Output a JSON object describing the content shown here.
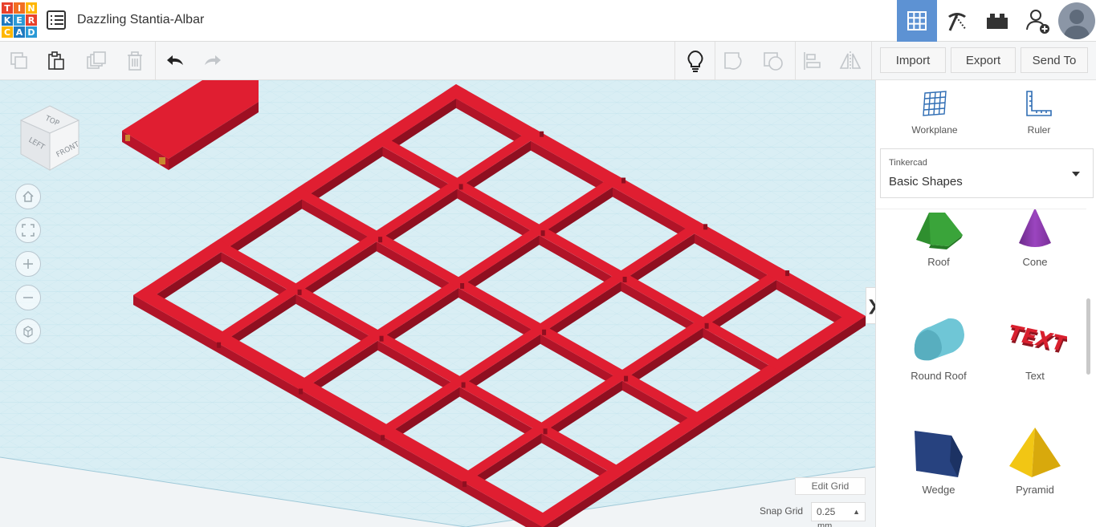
{
  "app": {
    "logo_letters": [
      "T",
      "I",
      "N",
      "K",
      "E",
      "R",
      "C",
      "A",
      "D"
    ],
    "logo_colors": [
      "#e8412c",
      "#f26e22",
      "#ffb600",
      "#1f7ac0",
      "#2b9ad6",
      "#e8412c",
      "#ffb600",
      "#1f7ac0",
      "#2b9ad6"
    ],
    "design_title": "Dazzling Stantia-Albar"
  },
  "header": {
    "buttons": [
      {
        "name": "3d-design-view-button",
        "icon": "grid-icon",
        "active": true
      },
      {
        "name": "codeblocks-button",
        "icon": "pickaxe-icon",
        "active": false
      },
      {
        "name": "bricks-button",
        "icon": "brick-icon",
        "active": false
      },
      {
        "name": "add-user-button",
        "icon": "user-plus-icon",
        "active": false
      }
    ],
    "active_color": "#5d92d3"
  },
  "toolbar": {
    "import_label": "Import",
    "export_label": "Export",
    "send_to_label": "Send To"
  },
  "viewcube": {
    "top": "TOP",
    "left": "LEFT",
    "front": "FRONT"
  },
  "canvas": {
    "grid_color": "#b9dfe9",
    "shape_color": "#e01e31",
    "edit_grid_label": "Edit Grid",
    "snap_grid_label": "Snap Grid",
    "snap_value": "0.25",
    "snap_unit": "mm"
  },
  "panel": {
    "tools": [
      {
        "label": "Workplane",
        "icon": "workplane-icon"
      },
      {
        "label": "Ruler",
        "icon": "ruler-icon"
      }
    ],
    "library": {
      "source": "Tinkercad",
      "selected": "Basic Shapes"
    },
    "shapes": [
      {
        "label": "Roof",
        "color": "#3aa43a"
      },
      {
        "label": "Cone",
        "color": "#8a3aa8"
      },
      {
        "label": "Round Roof",
        "color": "#6fc6d6"
      },
      {
        "label": "Text",
        "color": "#d9202e"
      },
      {
        "label": "Wedge",
        "color": "#27427f"
      },
      {
        "label": "Pyramid",
        "color": "#f2c614"
      }
    ]
  }
}
